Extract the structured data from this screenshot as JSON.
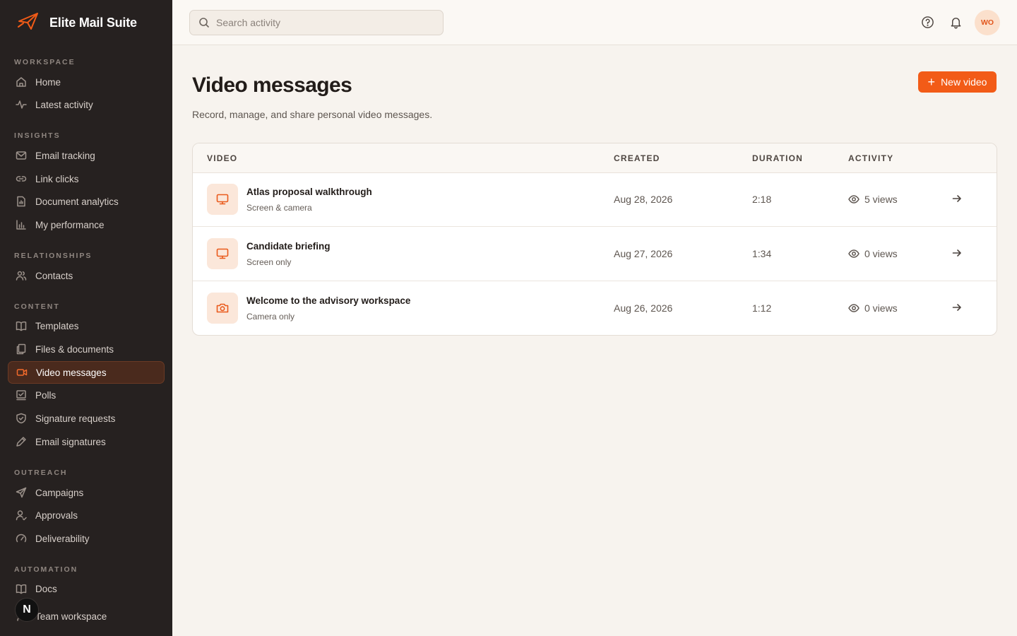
{
  "app": {
    "name": "Elite Mail Suite"
  },
  "sidebar": {
    "sections": [
      {
        "label": "WORKSPACE",
        "items": [
          {
            "label": "Home",
            "icon": "home-icon"
          },
          {
            "label": "Latest activity",
            "icon": "activity-icon"
          }
        ]
      },
      {
        "label": "INSIGHTS",
        "items": [
          {
            "label": "Email tracking",
            "icon": "mail-icon"
          },
          {
            "label": "Link clicks",
            "icon": "link-icon"
          },
          {
            "label": "Document analytics",
            "icon": "document-icon"
          },
          {
            "label": "My performance",
            "icon": "bar-chart-icon"
          }
        ]
      },
      {
        "label": "RELATIONSHIPS",
        "items": [
          {
            "label": "Contacts",
            "icon": "users-icon"
          }
        ]
      },
      {
        "label": "CONTENT",
        "items": [
          {
            "label": "Templates",
            "icon": "book-icon"
          },
          {
            "label": "Files & documents",
            "icon": "files-icon"
          },
          {
            "label": "Video messages",
            "icon": "video-icon",
            "active": true
          },
          {
            "label": "Polls",
            "icon": "poll-icon"
          },
          {
            "label": "Signature requests",
            "icon": "shield-icon"
          },
          {
            "label": "Email signatures",
            "icon": "pen-icon"
          }
        ]
      },
      {
        "label": "OUTREACH",
        "items": [
          {
            "label": "Campaigns",
            "icon": "send-icon"
          },
          {
            "label": "Approvals",
            "icon": "user-check-icon"
          },
          {
            "label": "Deliverability",
            "icon": "gauge-icon"
          }
        ]
      },
      {
        "label": "AUTOMATION",
        "items": [
          {
            "label": "Docs",
            "icon": "book-icon"
          },
          {
            "label": "Team workspace",
            "icon": "team-icon"
          }
        ]
      }
    ],
    "badge": "N"
  },
  "topbar": {
    "search_placeholder": "Search activity",
    "avatar_initials": "WO"
  },
  "main": {
    "title": "Video messages",
    "subtitle": "Record, manage, and share personal video messages.",
    "new_button": "New video",
    "columns": {
      "video": "VIDEO",
      "created": "CREATED",
      "duration": "DURATION",
      "activity": "ACTIVITY"
    },
    "rows": [
      {
        "title": "Atlas proposal walkthrough",
        "type": "Screen & camera",
        "created": "Aug 28, 2026",
        "duration": "2:18",
        "views": "5 views",
        "icon": "monitor-icon"
      },
      {
        "title": "Candidate briefing",
        "type": "Screen only",
        "created": "Aug 27, 2026",
        "duration": "1:34",
        "views": "0 views",
        "icon": "monitor-icon"
      },
      {
        "title": "Welcome to the advisory workspace",
        "type": "Camera only",
        "created": "Aug 26, 2026",
        "duration": "1:12",
        "views": "0 views",
        "icon": "camera-icon"
      }
    ]
  },
  "colors": {
    "accent": "#f25b17",
    "sidebar_bg": "#262120",
    "page_bg": "#f7f3ee"
  }
}
